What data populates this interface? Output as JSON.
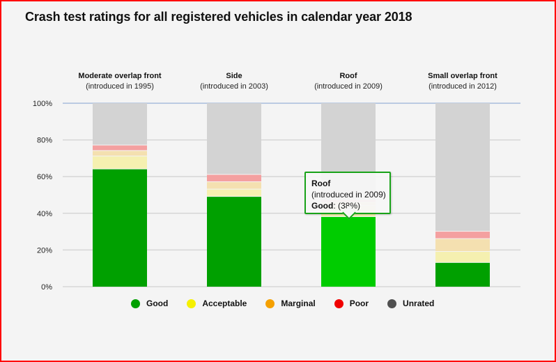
{
  "chart_data": {
    "type": "bar",
    "stacked": true,
    "title": "Crash test ratings for all registered vehicles in calendar year 2018",
    "categories": [
      {
        "name": "Moderate overlap front",
        "subtitle": "(introduced in 1995)"
      },
      {
        "name": "Side",
        "subtitle": "(introduced in 2003)"
      },
      {
        "name": "Roof",
        "subtitle": "(introduced in 2009)"
      },
      {
        "name": "Small overlap front",
        "subtitle": "(introduced in 2012)"
      }
    ],
    "series": [
      {
        "name": "Good",
        "color": "#00a000",
        "values": [
          64,
          49,
          38,
          13
        ]
      },
      {
        "name": "Acceptable",
        "color": "#f5f0b0",
        "values": [
          7,
          4,
          6,
          6
        ]
      },
      {
        "name": "Marginal",
        "color": "#f4e0b0",
        "values": [
          3,
          4,
          2,
          7
        ]
      },
      {
        "name": "Poor",
        "color": "#f4a0a0",
        "values": [
          3,
          4,
          1,
          4
        ]
      },
      {
        "name": "Unrated",
        "color": "#d3d3d3",
        "values": [
          23,
          39,
          53,
          70
        ]
      }
    ],
    "legend": [
      {
        "label": "Good",
        "color": "#00a000"
      },
      {
        "label": "Acceptable",
        "color": "#f5f000"
      },
      {
        "label": "Marginal",
        "color": "#f5a000"
      },
      {
        "label": "Poor",
        "color": "#f00000"
      },
      {
        "label": "Unrated",
        "color": "#505050"
      }
    ],
    "yticks": [
      "0%",
      "20%",
      "40%",
      "60%",
      "80%",
      "100%"
    ],
    "ylim": [
      0,
      100
    ],
    "xlabel": "",
    "ylabel": "",
    "grid": true,
    "legend_position": "bottom",
    "highlight_color": "#00cc00"
  },
  "tooltip": {
    "category": "Roof",
    "subtitle": "(introduced in 2009)",
    "series_label": "Good",
    "value_text": ": (38%)"
  }
}
